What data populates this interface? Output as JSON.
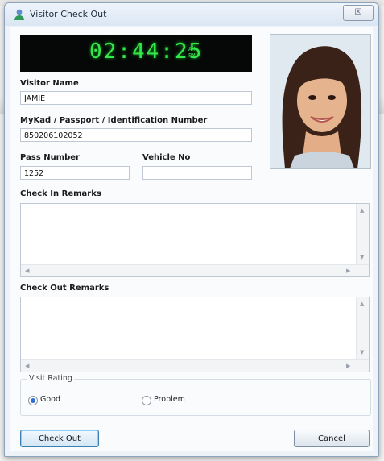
{
  "window": {
    "title": "Visitor Check Out",
    "close_glyph": "☒"
  },
  "clock": {
    "time": "02:44:25",
    "am": "AM",
    "pm": "PM",
    "digit_color": "#35e84a"
  },
  "form": {
    "visitor_name_label": "Visitor Name",
    "visitor_name_value": "JAMIE",
    "id_label": "MyKad / Passport / Identification Number",
    "id_value": "850206102052",
    "pass_number_label": "Pass Number",
    "pass_number_value": "1252",
    "vehicle_no_label": "Vehicle No",
    "vehicle_no_value": "",
    "check_in_remarks_label": "Check In Remarks",
    "check_in_remarks_value": "",
    "check_out_remarks_label": "Check Out Remarks",
    "check_out_remarks_value": ""
  },
  "rating": {
    "legend": "Visit Rating",
    "options": [
      {
        "label": "Good",
        "selected": true
      },
      {
        "label": "Problem",
        "selected": false
      }
    ]
  },
  "buttons": {
    "check_out": "Check Out",
    "cancel": "Cancel"
  },
  "icons": {
    "title": "user-icon",
    "photo": "visitor-photo"
  },
  "colors": {
    "accent": "#2f6fcf",
    "clock_background": "#050806"
  }
}
